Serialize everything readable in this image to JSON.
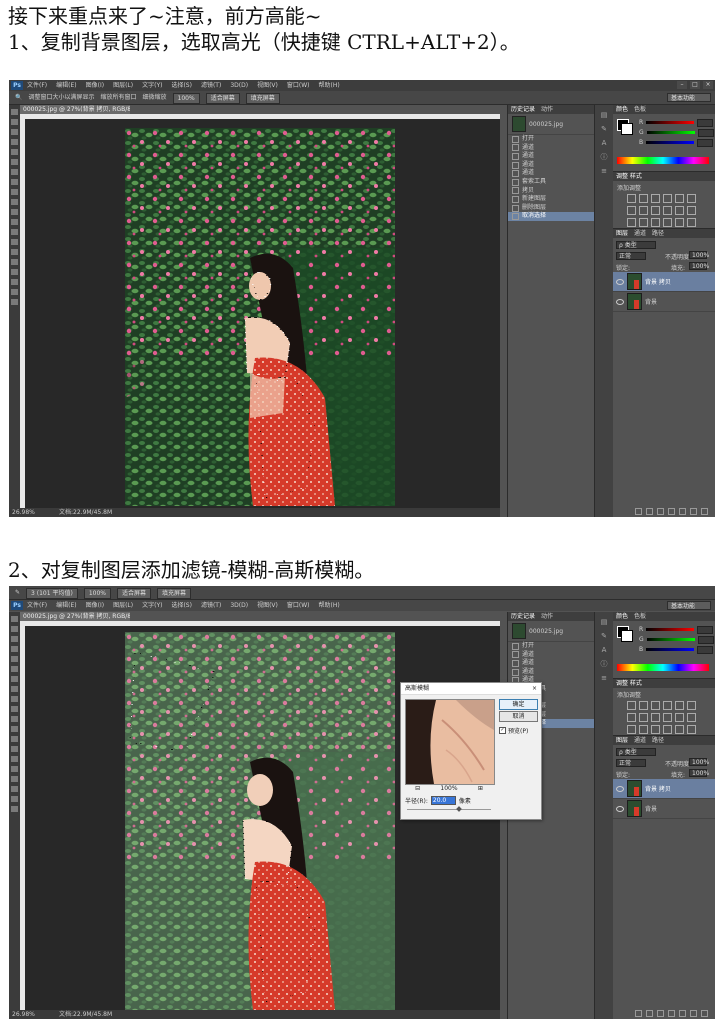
{
  "headings": {
    "intro": "接下来重点来了~注意，前方高能~",
    "step1": "1、复制背景图层，选取高光（快捷键 CTRL+ALT+2）。",
    "step2": "2、对复制图层添加滤镜-模糊-高斯模糊。"
  },
  "colors": {
    "ps_bg": "#535353",
    "menubar": "#3d3d3d",
    "canvas_bg": "#282828",
    "selection": "#6c83a3",
    "dress_red": "#d63a2a",
    "foliage": "#2d5a32"
  },
  "ps": {
    "logo": "Ps",
    "menus": [
      "文件(F)",
      "编辑(E)",
      "图像(I)",
      "图层(L)",
      "文字(Y)",
      "选择(S)",
      "滤镜(T)",
      "3D(D)",
      "视图(V)",
      "窗口(W)",
      "帮助(H)"
    ],
    "workspace": "基本功能",
    "window_controls": [
      "–",
      "□",
      "×"
    ],
    "doc_tab": "000025.jpg @ 27%(背景 拷贝, RGB/8) ×",
    "zoom": "26.98%",
    "doc_info": "文档:22.9M/45.8M",
    "history_tabs": [
      "历史记录",
      "动作"
    ],
    "snapshot_label": "000025.jpg",
    "history_items_1": [
      "打开",
      "通道",
      "通道",
      "通道",
      "通道",
      "套索工具",
      "拷贝",
      "新建图层",
      "删除图层",
      "取消选择"
    ],
    "history_items_2": [
      "打开",
      "通道",
      "通道",
      "通道",
      "通道",
      "套索工具",
      "拷贝",
      "新建图层",
      "删除图层",
      "取消选择"
    ],
    "color_tabs": [
      "颜色",
      "色板"
    ],
    "rgb_labels": [
      "R",
      "G",
      "B"
    ],
    "adj_title": "调整  样式",
    "adj_add": "添加调整",
    "layer_tabs": [
      "图层",
      "通道",
      "路径"
    ],
    "layer_kind": "ρ 类型",
    "blend_mode": "正常",
    "opacity_label": "不透明度:",
    "opacity_value": "100%",
    "lock_label": "锁定:",
    "fill_label": "填充:",
    "fill_value": "100%",
    "layers": [
      {
        "name": "背景 拷贝",
        "selected": true
      },
      {
        "name": "背景",
        "selected": false
      }
    ],
    "options_1": {
      "zoom_all": "调整窗口大小以满屏显示",
      "zoom_all2": "缩放所有窗口",
      "scrubby": "细微缩放",
      "btn_100": "100%",
      "btn_fit": "适合屏幕",
      "btn_fill": "填充屏幕"
    },
    "options_2": {
      "size_label": "3 (101 平均值)",
      "btn_100": "100%",
      "btn_fit": "适合屏幕",
      "btn_fill": "填充屏幕"
    }
  },
  "dialog": {
    "title": "高斯模糊",
    "close": "×",
    "ok": "确定",
    "cancel": "取消",
    "preview_label": "预览(P)",
    "zoom_out": "⊟",
    "zoom_pct": "100%",
    "zoom_in": "⊞",
    "radius_label": "半径(R):",
    "radius_value": "20.0",
    "radius_unit": "像素"
  }
}
